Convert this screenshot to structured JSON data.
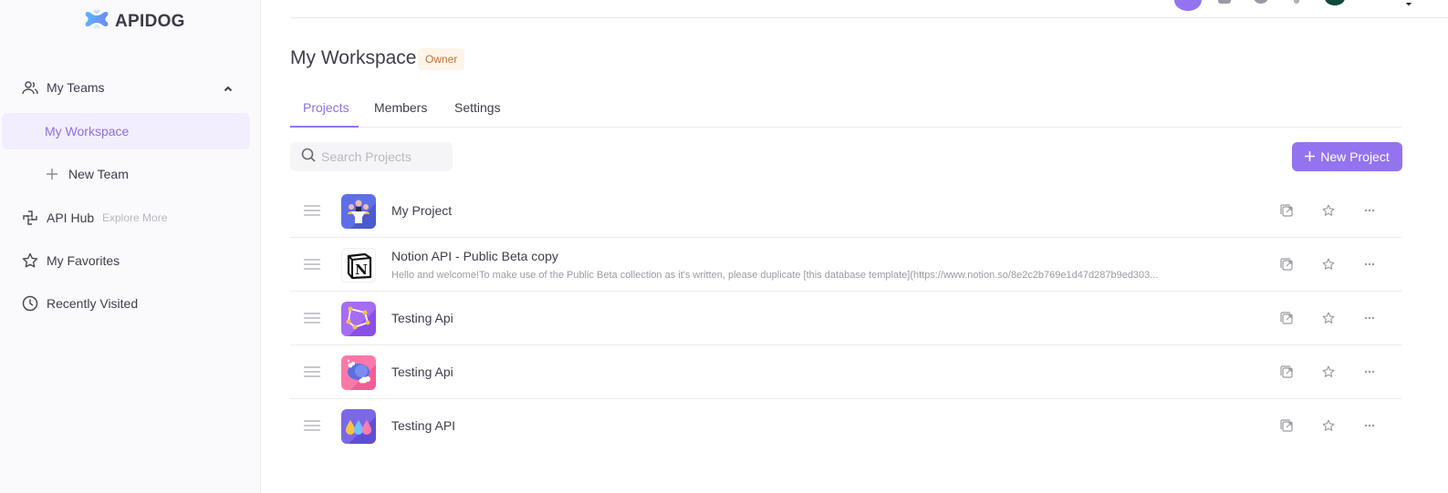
{
  "brand": {
    "name": "APIDOG",
    "accent": "#9373ee"
  },
  "sidebar": {
    "teams_label": "My Teams",
    "workspace_label": "My Workspace",
    "new_team_label": "New Team",
    "api_hub_label": "API Hub",
    "api_hub_sub": "Explore More",
    "favorites_label": "My Favorites",
    "recent_label": "Recently Visited"
  },
  "workspace": {
    "title": "My Workspace",
    "role_badge": "Owner"
  },
  "tabs": [
    {
      "label": "Projects",
      "active": true
    },
    {
      "label": "Members",
      "active": false
    },
    {
      "label": "Settings",
      "active": false
    }
  ],
  "search": {
    "placeholder": "Search Projects",
    "value": ""
  },
  "new_project_label": "New Project",
  "projects": [
    {
      "name": "My Project",
      "description": "",
      "icon": "people-presentation-icon"
    },
    {
      "name": "Notion API - Public Beta copy",
      "description": "Hello and welcome!To make use of the Public Beta collection as it's written, please duplicate [this database template](https://www.notion.so/8e2c2b769e1d47d287b9ed303...",
      "icon": "notion-icon"
    },
    {
      "name": "Testing Api",
      "description": "",
      "icon": "constellation-icon"
    },
    {
      "name": "Testing Api",
      "description": "",
      "icon": "cloud-icon"
    },
    {
      "name": "Testing API",
      "description": "",
      "icon": "drops-icon"
    }
  ]
}
